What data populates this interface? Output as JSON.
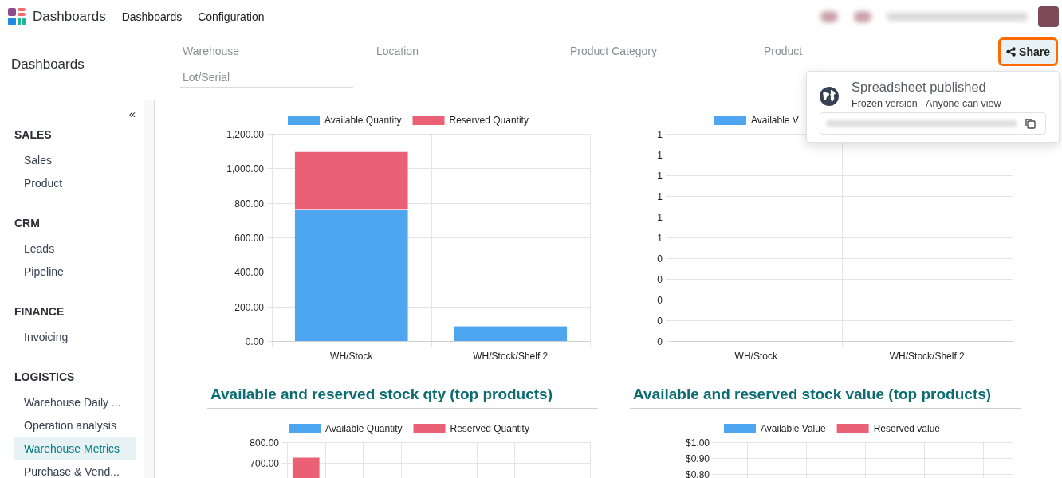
{
  "app": {
    "title": "Dashboards"
  },
  "top_menu": [
    {
      "label": "Dashboards"
    },
    {
      "label": "Configuration"
    }
  ],
  "control_panel": {
    "title": "Dashboards",
    "filters": [
      {
        "placeholder": "Warehouse"
      },
      {
        "placeholder": "Location"
      },
      {
        "placeholder": "Product Category"
      },
      {
        "placeholder": "Product"
      },
      {
        "placeholder": "Lot/Serial"
      }
    ],
    "share_button": {
      "label": "Share",
      "highlighted": true
    }
  },
  "share_popup": {
    "title": "Spreadsheet published",
    "subtitle": "Frozen version - Anyone can view"
  },
  "sidebar": {
    "collapse": "«",
    "groups": [
      {
        "title": "SALES",
        "items": [
          {
            "label": "Sales",
            "selected": false
          },
          {
            "label": "Product",
            "selected": false
          }
        ]
      },
      {
        "title": "CRM",
        "items": [
          {
            "label": "Leads",
            "selected": false
          },
          {
            "label": "Pipeline",
            "selected": false
          }
        ]
      },
      {
        "title": "FINANCE",
        "items": [
          {
            "label": "Invoicing",
            "selected": false
          }
        ]
      },
      {
        "title": "LOGISTICS",
        "items": [
          {
            "label": "Warehouse Daily ...",
            "selected": false
          },
          {
            "label": "Operation analysis",
            "selected": false
          },
          {
            "label": "Warehouse Metrics",
            "selected": true
          },
          {
            "label": "Purchase & Vend...",
            "selected": false
          }
        ]
      }
    ]
  },
  "charts": [
    {
      "chart_data": {
        "type": "bar",
        "stacked": true,
        "grid": true,
        "legend": "top",
        "categories": [
          "WH/Stock",
          "WH/Stock/Shelf 2"
        ],
        "ylim": [
          0,
          1200
        ],
        "yticks": [
          {
            "value": 0,
            "label": "0.00"
          },
          {
            "value": 200,
            "label": "200.00"
          },
          {
            "value": 400,
            "label": "400.00"
          },
          {
            "value": 600,
            "label": "600.00"
          },
          {
            "value": 800,
            "label": "800.00"
          },
          {
            "value": 1000,
            "label": "1,000.00"
          },
          {
            "value": 1200,
            "label": "1,200.00"
          }
        ],
        "series": [
          {
            "name": "Available Quantity",
            "color": "#4ea5f0",
            "values": [
              760,
              85
            ]
          },
          {
            "name": "Reserved Quantity",
            "color": "#ea6175",
            "values": [
              335,
              0
            ]
          }
        ]
      }
    },
    {
      "chart_data": {
        "type": "bar",
        "grid": true,
        "legend": "top",
        "categories": [
          "WH/Stock",
          "WH/Stock/Shelf 2"
        ],
        "ylim": [
          0,
          1
        ],
        "yticks": [
          {
            "value": 0,
            "label": "0"
          },
          {
            "value": 0.1,
            "label": "0"
          },
          {
            "value": 0.2,
            "label": "0"
          },
          {
            "value": 0.3,
            "label": "0"
          },
          {
            "value": 0.4,
            "label": "0"
          },
          {
            "value": 0.5,
            "label": "1"
          },
          {
            "value": 0.6,
            "label": "1"
          },
          {
            "value": 0.7,
            "label": "1"
          },
          {
            "value": 0.8,
            "label": "1"
          },
          {
            "value": 0.9,
            "label": "1"
          },
          {
            "value": 1,
            "label": "1"
          }
        ],
        "series": [
          {
            "name": "Available V",
            "color": "#4ea5f0",
            "values": [
              0,
              0
            ]
          }
        ]
      }
    },
    {
      "title": "Available and reserved stock qty (top products)",
      "chart_data": {
        "type": "bar",
        "stacked": true,
        "grid": true,
        "legend": "top",
        "ylim": [
          0,
          800
        ],
        "yticks": [
          {
            "value": 700,
            "label": "700.00"
          },
          {
            "value": 800,
            "label": "800.00"
          }
        ],
        "series": [
          {
            "name": "Available Quantity",
            "color": "#4ea5f0",
            "values": [
              null,
              null,
              null,
              null,
              null,
              null,
              null,
              null
            ]
          },
          {
            "name": "Reserved Quantity",
            "color": "#ea6175",
            "values": [
              725,
              null,
              null,
              null,
              null,
              null,
              null,
              null
            ]
          }
        ]
      }
    },
    {
      "title": "Available and reserved stock value (top products)",
      "chart_data": {
        "type": "bar",
        "stacked": true,
        "grid": true,
        "legend": "top",
        "ylim": [
          0,
          1
        ],
        "yticks": [
          {
            "value": 0.8,
            "label": "$0.80"
          },
          {
            "value": 0.9,
            "label": "$0.90"
          },
          {
            "value": 1,
            "label": "$1.00"
          }
        ],
        "series": [
          {
            "name": "Available Value",
            "color": "#4ea5f0",
            "values": [
              null,
              null,
              null,
              null,
              null,
              null,
              null,
              null,
              null,
              null
            ]
          },
          {
            "name": "Reserved value",
            "color": "#ea6175",
            "values": [
              null,
              null,
              null,
              null,
              null,
              null,
              null,
              null,
              null,
              null
            ]
          }
        ]
      }
    }
  ]
}
